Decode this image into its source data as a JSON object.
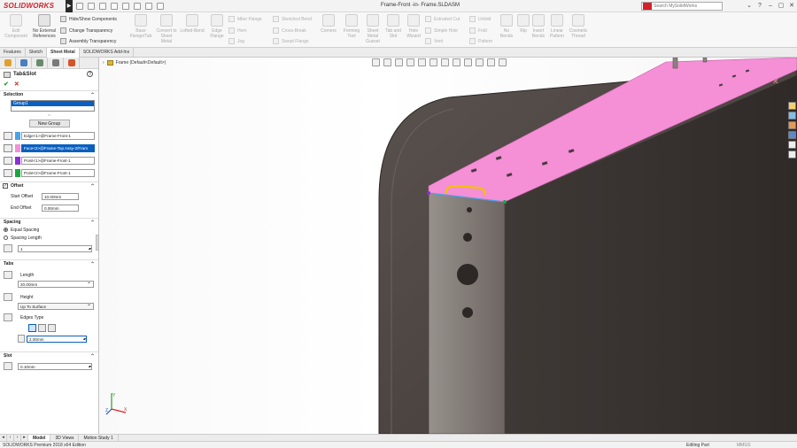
{
  "app": {
    "logo_text": "SOLIDWORKS",
    "document_title": "Frame-Front -in- Frame.SLDASM",
    "search_placeholder": "Search MySolidWorks",
    "accent": "#d42028"
  },
  "ribbon": {
    "large": [
      {
        "label": "Edit Component",
        "dim": true
      },
      {
        "label": "No External References",
        "dim": false
      }
    ],
    "assembly_small": [
      {
        "label": "Hide/Show Components"
      },
      {
        "label": "Change Transparency"
      },
      {
        "label": "Assembly Transparency"
      }
    ],
    "sheet_metal_large": [
      {
        "label": "Base Flange/Tab"
      },
      {
        "label": "Convert to Sheet Metal"
      },
      {
        "label": "Lofted-Bend"
      },
      {
        "label": "Edge Flange"
      }
    ],
    "sheet_metal_small_1": [
      {
        "label": "Miter Flange"
      },
      {
        "label": "Hem"
      },
      {
        "label": "Jog"
      }
    ],
    "sheet_metal_small_2": [
      {
        "label": "Sketched Bend"
      },
      {
        "label": "Cross-Break"
      },
      {
        "label": "Swept Flange"
      }
    ],
    "sheet_metal_large_2": [
      {
        "label": "Corners"
      },
      {
        "label": "Forming Tool"
      },
      {
        "label": "Sheet Metal Gusset"
      },
      {
        "label": "Tab and Slot"
      },
      {
        "label": "Vent"
      }
    ],
    "sheet_metal_small_3": [
      {
        "label": "Extruded Cut"
      },
      {
        "label": "Simple Hole"
      },
      {
        "label": "Vent"
      }
    ],
    "sheet_metal_large_3": [
      {
        "label": "Hole Wizard"
      }
    ],
    "sheet_metal_small_4": [
      {
        "label": "Unfold"
      },
      {
        "label": "Fold"
      },
      {
        "label": "Pattern"
      }
    ],
    "sheet_metal_large_4": [
      {
        "label": "No Bends"
      },
      {
        "label": "Rip"
      },
      {
        "label": "Insert Bends"
      },
      {
        "label": "Linear Pattern"
      },
      {
        "label": "Cosmetic Thread"
      }
    ]
  },
  "command_tabs": [
    "Features",
    "Sketch",
    "Sheet Metal",
    "SOLIDWORKS Add-Ins"
  ],
  "property_manager": {
    "title": "Tab&Slot",
    "help_glyph": "?",
    "ok_glyph": "✔",
    "cancel_glyph": "✕",
    "selection": {
      "header": "Selection",
      "group_item": "Group1",
      "tiny_marker": "o",
      "new_group_label": "New Group",
      "entities": [
        {
          "text": "Edge<1>@Frame-Front-1",
          "color": "#4aa3e8",
          "highlight": false
        },
        {
          "text": "Face<2>@Frame-Top Assy-2/Fram",
          "color": "#f58fd6",
          "highlight": true
        },
        {
          "text": "Point<1>@Frame-Front-1",
          "color": "#8b2fd6",
          "highlight": false
        },
        {
          "text": "Point<2>@Frame-Front-1",
          "color": "#1aa640",
          "highlight": false
        }
      ]
    },
    "offset": {
      "header": "Offset",
      "start_label": "Start Offset",
      "start_value": "10.00mm",
      "end_label": "End Offset",
      "end_value": "0.00mm"
    },
    "spacing": {
      "header": "Spacing",
      "option1": "Equal Spacing",
      "option2": "Spacing Length",
      "count": "1"
    },
    "tabs": {
      "header": "Tabs",
      "length_label": "Length",
      "length_value": "20.00mm",
      "height_label": "Height",
      "height_option": "Up To Surface",
      "edges_label": "Edges Type",
      "edge_value": "2.00mm"
    },
    "slot": {
      "header": "Slot",
      "value": "0.10mm"
    }
  },
  "viewport": {
    "tree_root": "Frame  (Default<Default>)",
    "face_highlight_color": "#f58fd6",
    "edge_color": "#f2c200"
  },
  "bottom_tabs": [
    "Model",
    "3D Views",
    "Motion Study 1"
  ],
  "status": {
    "edition": "SOLIDWORKS Premium 2018 x64 Edition",
    "mode": "Editing Part",
    "units": "MMGS"
  }
}
